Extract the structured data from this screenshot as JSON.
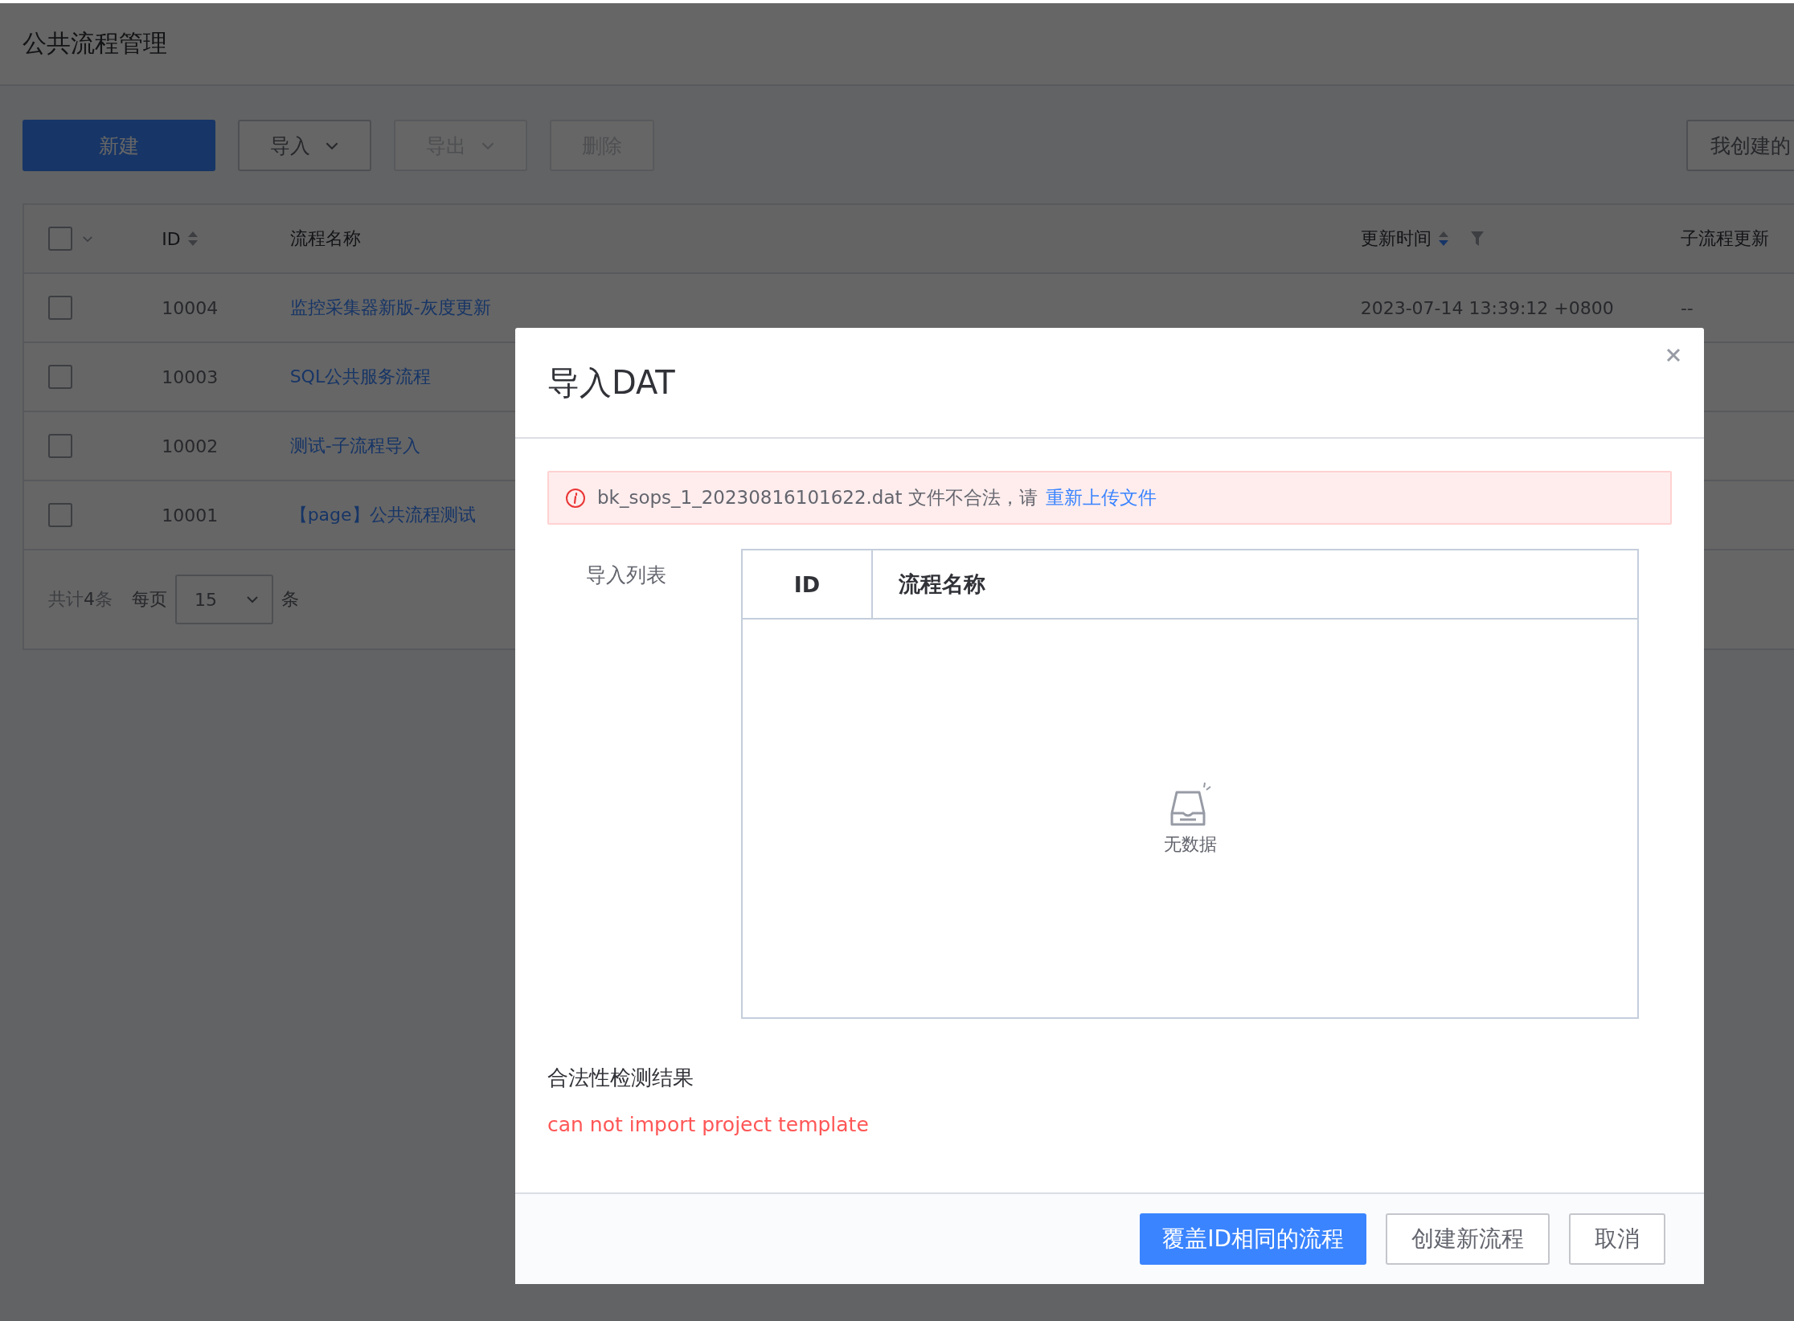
{
  "page": {
    "title": "公共流程管理"
  },
  "toolbar": {
    "buttons": [
      {
        "label": "新建",
        "kind": "primary",
        "disabled": false,
        "dropdown": false
      },
      {
        "label": "导入",
        "kind": "default",
        "disabled": false,
        "dropdown": true
      },
      {
        "label": "导出",
        "kind": "default",
        "disabled": true,
        "dropdown": true
      },
      {
        "label": "删除",
        "kind": "default",
        "disabled": true,
        "dropdown": false
      }
    ],
    "filter_button": "我创建的"
  },
  "table": {
    "columns": [
      {
        "label": "ID",
        "sortable": true,
        "sorted_desc": false
      },
      {
        "label": "流程名称"
      },
      {
        "label": "更新时间",
        "sortable": true,
        "sorted_desc": true,
        "filterable": true
      },
      {
        "label": "子流程更新"
      }
    ],
    "rows": [
      {
        "checked": false,
        "id": "10004",
        "name": "监控采集器新版-灰度更新",
        "updated": "2023-07-14 13:39:12 +0800",
        "subprocess": "--"
      },
      {
        "checked": false,
        "id": "10003",
        "name": "SQL公共服务流程"
      },
      {
        "checked": false,
        "id": "10002",
        "name": "测试-子流程导入"
      },
      {
        "checked": false,
        "id": "10001",
        "name": "【page】公共流程测试"
      }
    ],
    "select_all": {
      "checked": false
    },
    "pagination": {
      "total": "共计**4**条",
      "per_page_label": "每页",
      "per_page": "15",
      "unit": "条"
    }
  },
  "dialog": {
    "title": "导入DAT",
    "alert": {
      "message": "bk_sops_1_20230816101622.dat 文件不合法，请",
      "link": "重新上传文件"
    },
    "import_list": {
      "label": "导入列表",
      "columns": [
        "ID",
        "流程名称"
      ],
      "empty_text": "无数据"
    },
    "check_result": {
      "title": "合法性检测结果",
      "message": "can not import project template"
    },
    "buttons": [
      {
        "label": "覆盖ID相同的流程",
        "kind": "primary"
      },
      {
        "label": "创建新流程",
        "kind": "default"
      },
      {
        "label": "取消",
        "kind": "default"
      }
    ]
  }
}
